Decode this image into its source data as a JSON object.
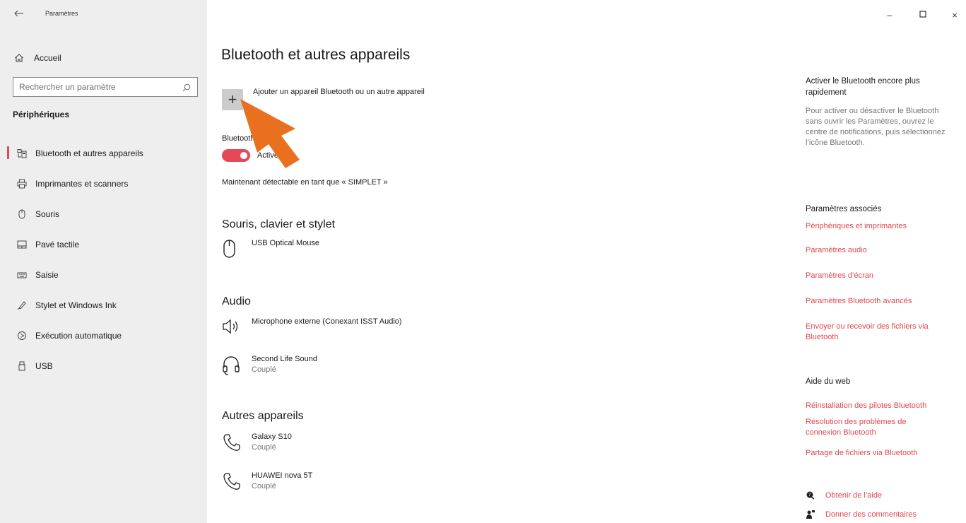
{
  "window": {
    "title": "Paramètres",
    "controls": {
      "minimize": "–",
      "maximize": "ㅁ",
      "close": "×"
    }
  },
  "sidebar": {
    "home_label": "Accueil",
    "search_placeholder": "Rechercher un paramètre",
    "section": "Périphériques",
    "items": [
      {
        "label": "Bluetooth et autres appareils",
        "icon": "bluetooth-devices-icon",
        "selected": true
      },
      {
        "label": "Imprimantes et scanners",
        "icon": "printer-icon",
        "selected": false
      },
      {
        "label": "Souris",
        "icon": "mouse-icon",
        "selected": false
      },
      {
        "label": "Pavé tactile",
        "icon": "touchpad-icon",
        "selected": false
      },
      {
        "label": "Saisie",
        "icon": "keyboard-icon",
        "selected": false
      },
      {
        "label": "Stylet et Windows Ink",
        "icon": "pen-icon",
        "selected": false
      },
      {
        "label": "Exécution automatique",
        "icon": "autoplay-icon",
        "selected": false
      },
      {
        "label": "USB",
        "icon": "usb-icon",
        "selected": false
      }
    ]
  },
  "main": {
    "title": "Bluetooth et autres appareils",
    "add_device_label": "Ajouter un appareil Bluetooth ou un autre appareil",
    "bluetooth_label": "Bluetooth",
    "toggle_label": "Activé",
    "toggle_on": true,
    "discoverable": "Maintenant détectable en tant que « SIMPLET »",
    "groups": [
      {
        "title": "Souris, clavier et stylet",
        "devices": [
          {
            "name": "USB Optical Mouse",
            "status": "",
            "icon": "mouse-icon"
          }
        ]
      },
      {
        "title": "Audio",
        "devices": [
          {
            "name": "Microphone externe (Conexant ISST Audio)",
            "status": "",
            "icon": "speaker-icon"
          },
          {
            "name": "Second Life Sound",
            "status": "Couplé",
            "icon": "headset-icon"
          }
        ]
      },
      {
        "title": "Autres appareils",
        "devices": [
          {
            "name": "Galaxy S10",
            "status": "Couplé",
            "icon": "phone-icon"
          },
          {
            "name": "HUAWEI nova 5T",
            "status": "Couplé",
            "icon": "phone-icon"
          }
        ]
      }
    ]
  },
  "right_panel": {
    "tip_title": "Activer le Bluetooth encore plus rapidement",
    "tip_text": "Pour activer ou désactiver le Bluetooth sans ouvrir les Paramètres, ouvrez le centre de notifications, puis sélectionnez l’icône Bluetooth.",
    "related_title": "Paramètres associés",
    "related_links": [
      "Périphériques et imprimantes",
      "Paramètres audio",
      "Paramètres d’écran",
      "Paramètres Bluetooth avancés",
      "Envoyer ou recevoir des fichiers via Bluetooth"
    ],
    "web_help_title": "Aide du web",
    "web_help_links": [
      "Réinstallation des pilotes Bluetooth",
      "Résolution des problèmes de connexion Bluetooth",
      "Partage de fichiers via Bluetooth"
    ],
    "get_help": "Obtenir de l’aide",
    "feedback": "Donner des commentaires"
  },
  "colors": {
    "accent": "#e74856",
    "link": "#e0464e",
    "arrow": "#e8701e",
    "sidebar_bg": "#eeeeee"
  }
}
